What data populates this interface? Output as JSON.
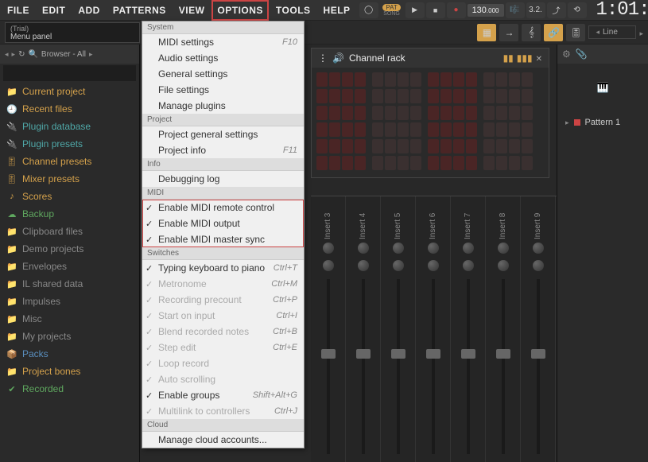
{
  "menubar": [
    "FILE",
    "EDIT",
    "ADD",
    "PATTERNS",
    "VIEW",
    "OPTIONS",
    "TOOLS",
    "HELP"
  ],
  "menubar_highlight_index": 5,
  "transport": {
    "pat_label": "PAT",
    "song_label": "SONG",
    "tempo_int": "130",
    "tempo_dec": ".000",
    "time": "1:01:"
  },
  "info_panel": {
    "line1": "(Trial)",
    "line2": "Menu panel"
  },
  "snap": {
    "label": "Line"
  },
  "browser": {
    "title": "Browser - All",
    "items": [
      {
        "label": "Current project",
        "color": "orange",
        "icon": "📁"
      },
      {
        "label": "Recent files",
        "color": "orange",
        "icon": "🕘"
      },
      {
        "label": "Plugin database",
        "color": "teal",
        "icon": "🔌"
      },
      {
        "label": "Plugin presets",
        "color": "teal",
        "icon": "🔌"
      },
      {
        "label": "Channel presets",
        "color": "orange",
        "icon": "🎚"
      },
      {
        "label": "Mixer presets",
        "color": "orange",
        "icon": "🎚"
      },
      {
        "label": "Scores",
        "color": "orange",
        "icon": "♪"
      },
      {
        "label": "Backup",
        "color": "green",
        "icon": "☁"
      },
      {
        "label": "Clipboard files",
        "color": "gray",
        "icon": "📁"
      },
      {
        "label": "Demo projects",
        "color": "gray",
        "icon": "📁"
      },
      {
        "label": "Envelopes",
        "color": "gray",
        "icon": "📁"
      },
      {
        "label": "IL shared data",
        "color": "gray",
        "icon": "📁"
      },
      {
        "label": "Impulses",
        "color": "gray",
        "icon": "📁"
      },
      {
        "label": "Misc",
        "color": "gray",
        "icon": "📁"
      },
      {
        "label": "My projects",
        "color": "gray",
        "icon": "📁"
      },
      {
        "label": "Packs",
        "color": "blue",
        "icon": "📦"
      },
      {
        "label": "Project bones",
        "color": "orange",
        "icon": "📁"
      },
      {
        "label": "Recorded",
        "color": "green",
        "icon": "✔"
      }
    ]
  },
  "channel_rack": {
    "title": "Channel rack"
  },
  "mixer_tracks": [
    "Insert 3",
    "Insert 4",
    "Insert 5",
    "Insert 6",
    "Insert 7",
    "Insert 8",
    "Insert 9"
  ],
  "playlist": {
    "pattern": "Pattern 1"
  },
  "dropdown": {
    "sections": [
      {
        "title": "System",
        "items": [
          {
            "label": "MIDI settings",
            "shortcut": "F10"
          },
          {
            "label": "Audio settings"
          },
          {
            "label": "General settings"
          },
          {
            "label": "File settings"
          },
          {
            "label": "Manage plugins"
          }
        ]
      },
      {
        "title": "Project",
        "items": [
          {
            "label": "Project general settings"
          },
          {
            "label": "Project info",
            "shortcut": "F11"
          }
        ]
      },
      {
        "title": "Info",
        "items": [
          {
            "label": "Debugging log"
          }
        ]
      },
      {
        "title": "MIDI",
        "highlight": true,
        "items": [
          {
            "label": "Enable MIDI remote control",
            "checked": true
          },
          {
            "label": "Enable MIDI output",
            "checked": true
          },
          {
            "label": "Enable MIDI master sync",
            "checked": true
          }
        ]
      },
      {
        "title": "Switches",
        "items": [
          {
            "label": "Typing keyboard to piano",
            "checked": true,
            "shortcut": "Ctrl+T"
          },
          {
            "label": "Metronome",
            "checked": true,
            "grayed": true,
            "shortcut": "Ctrl+M"
          },
          {
            "label": "Recording precount",
            "checked": true,
            "grayed": true,
            "shortcut": "Ctrl+P"
          },
          {
            "label": "Start on input",
            "checked": true,
            "grayed": true,
            "shortcut": "Ctrl+I"
          },
          {
            "label": "Blend recorded notes",
            "checked": true,
            "grayed": true,
            "shortcut": "Ctrl+B"
          },
          {
            "label": "Step edit",
            "checked": true,
            "grayed": true,
            "shortcut": "Ctrl+E"
          },
          {
            "label": "Loop record",
            "checked": true,
            "grayed": true
          },
          {
            "label": "Auto scrolling",
            "checked": true,
            "grayed": true
          },
          {
            "label": "Enable groups",
            "checked": true,
            "shortcut": "Shift+Alt+G"
          },
          {
            "label": "Multilink to controllers",
            "checked": true,
            "grayed": true,
            "shortcut": "Ctrl+J"
          }
        ]
      },
      {
        "title": "Cloud",
        "items": [
          {
            "label": "Manage cloud accounts..."
          }
        ]
      }
    ]
  }
}
